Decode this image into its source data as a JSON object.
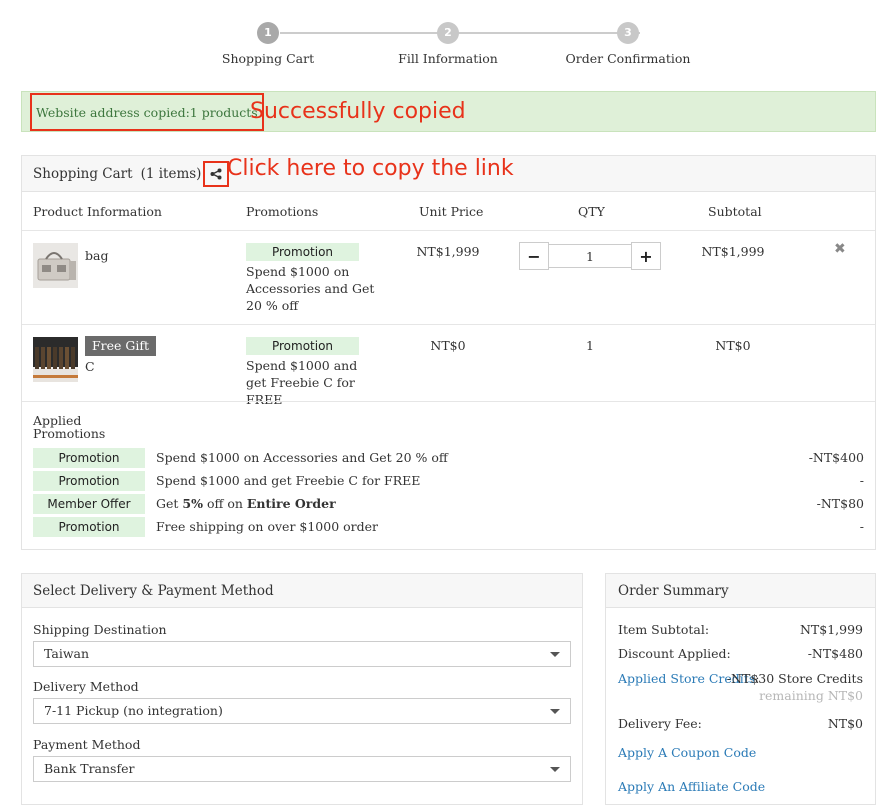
{
  "stepper": {
    "steps": [
      {
        "number": "1",
        "label": "Shopping Cart"
      },
      {
        "number": "2",
        "label": "Fill Information"
      },
      {
        "number": "3",
        "label": "Order Confirmation"
      }
    ]
  },
  "alert": {
    "text": "Website address copied:1 products",
    "annotation": "Successfully copied"
  },
  "cart": {
    "title": "Shopping Cart",
    "count": "(1 items)",
    "share_annotation": "Click here to copy the link",
    "columns": [
      "Product Information",
      "Promotions",
      "Unit Price",
      "QTY",
      "Subtotal"
    ],
    "items": [
      {
        "name": "bag",
        "promo_tag": "Promotion",
        "promo_desc": "Spend $1000 on Accessories and Get 20 % off",
        "unit_price": "NT$1,999",
        "qty": "1",
        "subtotal": "NT$1,999"
      },
      {
        "badge": "Free Gift",
        "name": "C",
        "promo_tag": "Promotion",
        "promo_desc": "Spend $1000 and get Freebie C for FREE",
        "unit_price": "NT$0",
        "qty": "1",
        "subtotal": "NT$0"
      }
    ],
    "applied_title": "Applied Promotions",
    "applied": [
      {
        "tag": "Promotion",
        "desc": "Spend $1000 on Accessories and Get 20 % off",
        "amount": "-NT$400"
      },
      {
        "tag": "Promotion",
        "desc": "Spend $1000 and get Freebie C for FREE",
        "amount": "-"
      },
      {
        "tag": "Member Offer",
        "desc_pre": "Get ",
        "desc_b1": "5%",
        "desc_mid": " off on ",
        "desc_b2": "Entire Order",
        "amount": "-NT$80"
      },
      {
        "tag": "Promotion",
        "desc": "Free shipping on over $1000 order",
        "amount": "-"
      }
    ]
  },
  "delivery": {
    "title": "Select Delivery & Payment Method",
    "shipping_label": "Shipping Destination",
    "shipping_value": "Taiwan",
    "method_label": "Delivery Method",
    "method_value": "7-11 Pickup (no integration)",
    "payment_label": "Payment Method",
    "payment_value": "Bank Transfer"
  },
  "summary": {
    "title": "Order Summary",
    "subtotal_label": "Item Subtotal:",
    "subtotal_value": "NT$1,999",
    "discount_label": "Discount Applied:",
    "discount_value": "-NT$480",
    "credits_label": "Applied Store Credits",
    "credits_colon": ":",
    "credits_value": "-NT$30 Store Credits",
    "credits_remaining": "remaining NT$0",
    "fee_label": "Delivery Fee:",
    "fee_value": "NT$0",
    "coupon_link": "Apply A Coupon Code",
    "affiliate_link": "Apply An Affiliate Code"
  }
}
